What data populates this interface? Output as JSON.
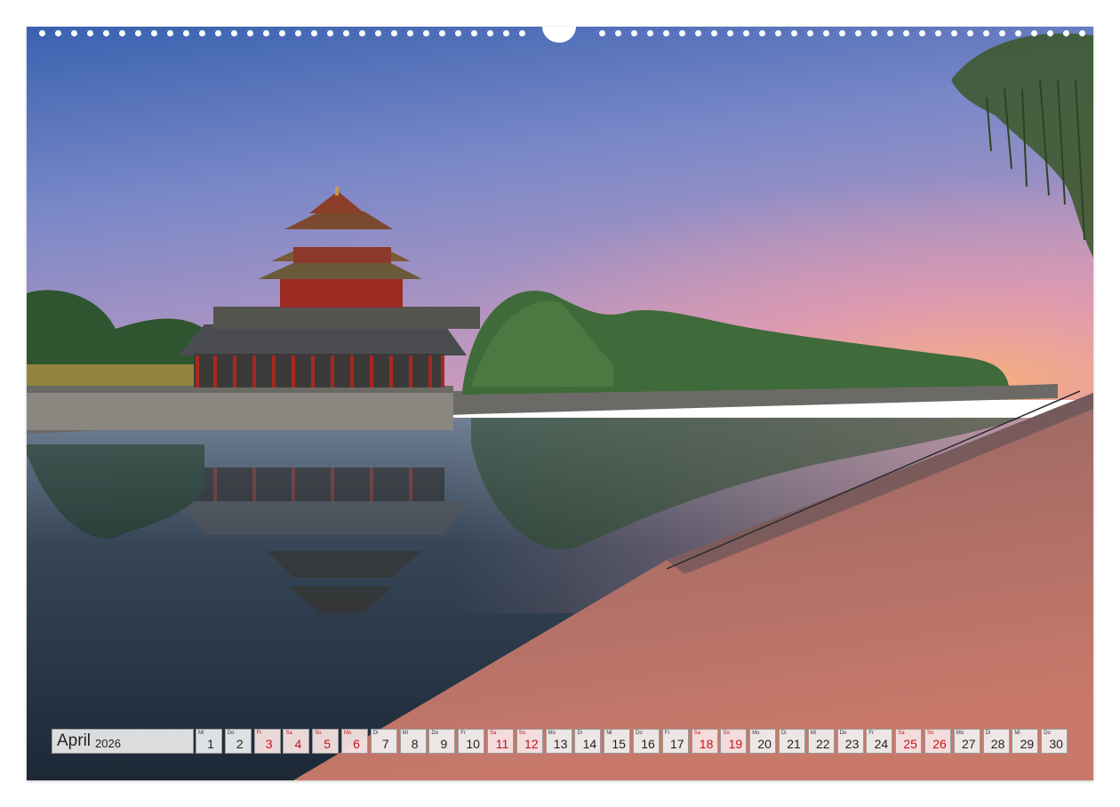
{
  "calendar": {
    "month": "April",
    "year": "2026",
    "days": [
      {
        "wd": "Mi",
        "n": "1",
        "we": false
      },
      {
        "wd": "Do",
        "n": "2",
        "we": false
      },
      {
        "wd": "Fr",
        "n": "3",
        "we": true
      },
      {
        "wd": "Sa",
        "n": "4",
        "we": true
      },
      {
        "wd": "So",
        "n": "5",
        "we": true
      },
      {
        "wd": "Mo",
        "n": "6",
        "we": true
      },
      {
        "wd": "Di",
        "n": "7",
        "we": false
      },
      {
        "wd": "Mi",
        "n": "8",
        "we": false
      },
      {
        "wd": "Do",
        "n": "9",
        "we": false
      },
      {
        "wd": "Fr",
        "n": "10",
        "we": false
      },
      {
        "wd": "Sa",
        "n": "11",
        "we": true
      },
      {
        "wd": "So",
        "n": "12",
        "we": true
      },
      {
        "wd": "Mo",
        "n": "13",
        "we": false
      },
      {
        "wd": "Di",
        "n": "14",
        "we": false
      },
      {
        "wd": "Mi",
        "n": "15",
        "we": false
      },
      {
        "wd": "Do",
        "n": "16",
        "we": false
      },
      {
        "wd": "Fr",
        "n": "17",
        "we": false
      },
      {
        "wd": "Sa",
        "n": "18",
        "we": true
      },
      {
        "wd": "So",
        "n": "19",
        "we": true
      },
      {
        "wd": "Mo",
        "n": "20",
        "we": false
      },
      {
        "wd": "Di",
        "n": "21",
        "we": false
      },
      {
        "wd": "Mi",
        "n": "22",
        "we": false
      },
      {
        "wd": "Do",
        "n": "23",
        "we": false
      },
      {
        "wd": "Fr",
        "n": "24",
        "we": false
      },
      {
        "wd": "Sa",
        "n": "25",
        "we": true
      },
      {
        "wd": "So",
        "n": "26",
        "we": true
      },
      {
        "wd": "Mo",
        "n": "27",
        "we": false
      },
      {
        "wd": "Di",
        "n": "28",
        "we": false
      },
      {
        "wd": "Mi",
        "n": "29",
        "we": false
      },
      {
        "wd": "Do",
        "n": "30",
        "we": false
      }
    ]
  },
  "colors": {
    "weekend_text": "#c0141c",
    "sky_top": "#3a62b0",
    "sky_glow": "#f4a27a",
    "pavilion_red": "#9c2a22"
  }
}
